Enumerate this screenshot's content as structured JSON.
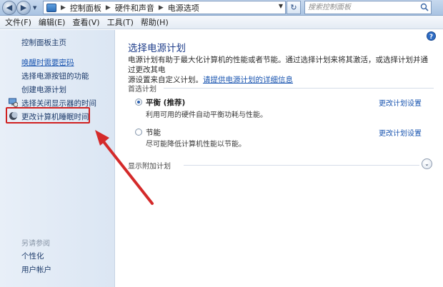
{
  "address_bar": {
    "crumbs": [
      "控制面板",
      "硬件和声音",
      "电源选项"
    ],
    "search_placeholder": "搜索控制面板"
  },
  "menu": {
    "items": [
      "文件(F)",
      "编辑(E)",
      "查看(V)",
      "工具(T)",
      "帮助(H)"
    ]
  },
  "sidebar": {
    "home": "控制面板主页",
    "links": [
      "唤醒时需要密码",
      "选择电源按钮的功能",
      "创建电源计划",
      "选择关闭显示器的时间",
      "更改计算机睡眠时间"
    ],
    "see_also_title": "另请参阅",
    "see_also": [
      "个性化",
      "用户帐户"
    ]
  },
  "main": {
    "title": "选择电源计划",
    "desc_line1": "电源计划有助于最大化计算机的性能或者节能。通过选择计划来将其激活，或选择计划并通过更改其电",
    "desc_line2": "源设置来自定义计划。",
    "desc_link": "请提供电源计划的详细信息",
    "preferred_label": "首选计划",
    "plans": [
      {
        "name": "平衡 (推荐)",
        "desc": "利用可用的硬件自动平衡功耗与性能。",
        "change": "更改计划设置",
        "selected": true
      },
      {
        "name": "节能",
        "desc": "尽可能降低计算机性能以节能。",
        "change": "更改计划设置",
        "selected": false
      }
    ],
    "extra_label": "显示附加计划"
  },
  "colors": {
    "accent_link": "#1a55b0",
    "title_blue": "#1e3d8a",
    "highlight_red": "#d02020"
  }
}
